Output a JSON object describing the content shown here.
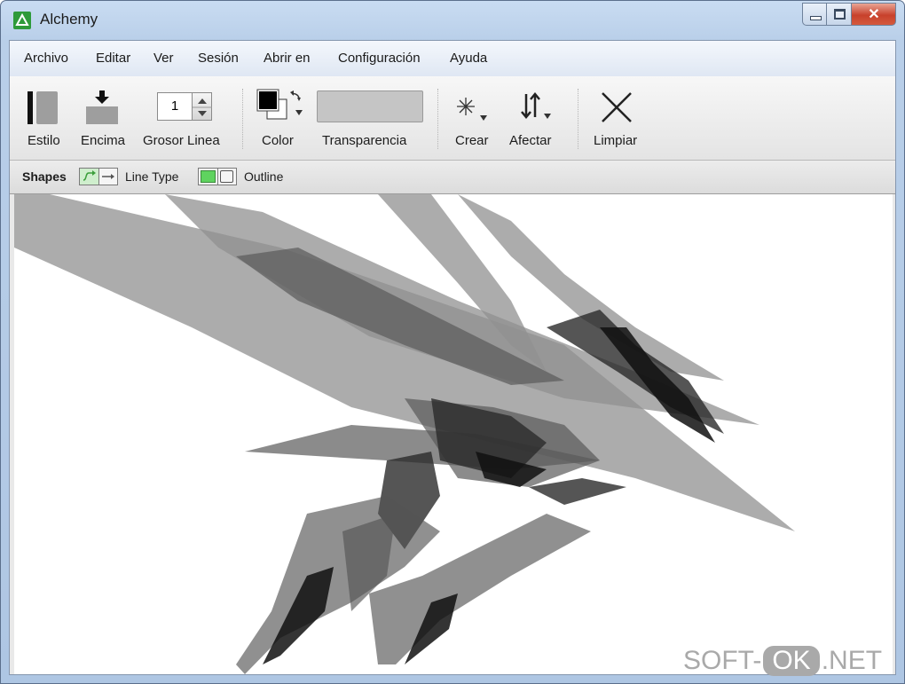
{
  "window": {
    "title": "Alchemy",
    "close_glyph": "✕"
  },
  "menu": {
    "items": [
      "Archivo",
      "Editar",
      "Ver",
      "Sesión",
      "Abrir en",
      "Configuración",
      "Ayuda"
    ]
  },
  "toolbar": {
    "estilo": "Estilo",
    "encima": "Encima",
    "grosor": "Grosor Linea",
    "grosor_value": "1",
    "color": "Color",
    "transparencia": "Transparencia",
    "crear": "Crear",
    "afectar": "Afectar",
    "limpiar": "Limpiar"
  },
  "subbar": {
    "shapes": "Shapes",
    "line_type": "Line Type",
    "outline": "Outline"
  },
  "watermark": {
    "left": "SOFT-",
    "pill": "OK",
    "right": ".NET"
  },
  "colors": {
    "accent_green": "#2e9a3a",
    "toggle_green": "#5fd35f"
  }
}
